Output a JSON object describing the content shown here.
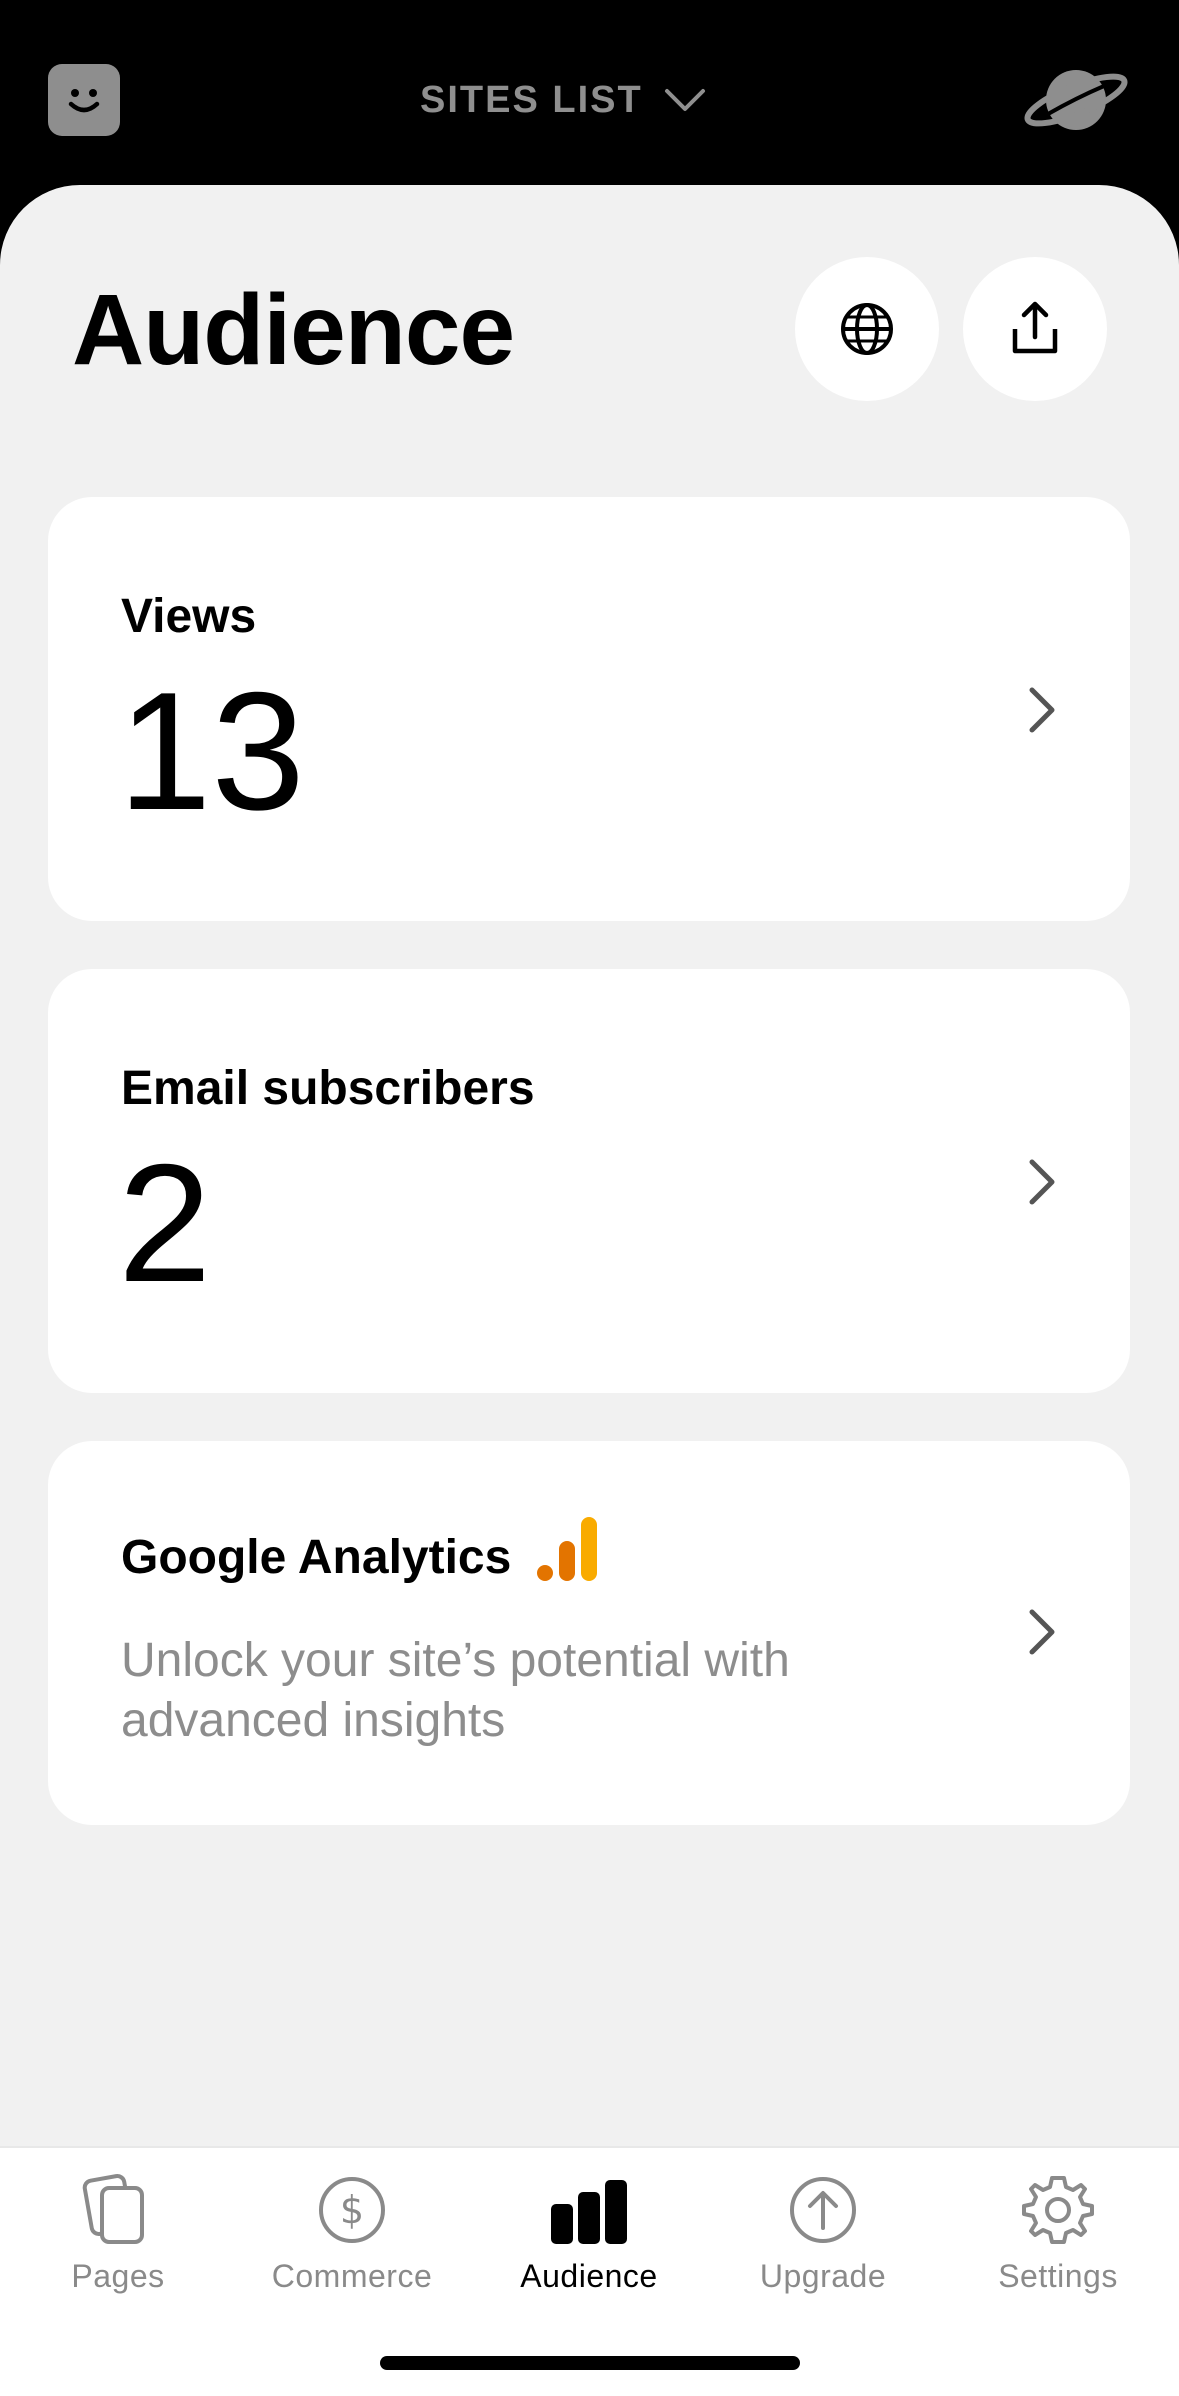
{
  "topbar": {
    "sites_label": "SITES LIST",
    "avatar_icon": "smiley-face-icon",
    "planet_icon": "planet-icon",
    "chevron_icon": "chevron-down-icon"
  },
  "page": {
    "title": "Audience",
    "globe_icon": "globe-icon",
    "share_icon": "share-icon"
  },
  "cards": {
    "views": {
      "label": "Views",
      "value": "13"
    },
    "email": {
      "label": "Email subscribers",
      "value": "2"
    },
    "ga": {
      "label": "Google Analytics",
      "description": "Unlock your site’s potential with advanced insights",
      "icon": "google-analytics-icon"
    }
  },
  "tabs": [
    {
      "label": "Pages",
      "icon": "pages-icon"
    },
    {
      "label": "Commerce",
      "icon": "dollar-icon"
    },
    {
      "label": "Audience",
      "icon": "bar-chart-icon",
      "active": true
    },
    {
      "label": "Upgrade",
      "icon": "upgrade-arrow-icon"
    },
    {
      "label": "Settings",
      "icon": "gear-icon"
    }
  ],
  "colors": {
    "background": "#f1f1f1",
    "topbar": "#000000",
    "muted": "#8a8a8a",
    "ga_orange": "#f9ab00",
    "ga_dark_orange": "#e37400"
  }
}
